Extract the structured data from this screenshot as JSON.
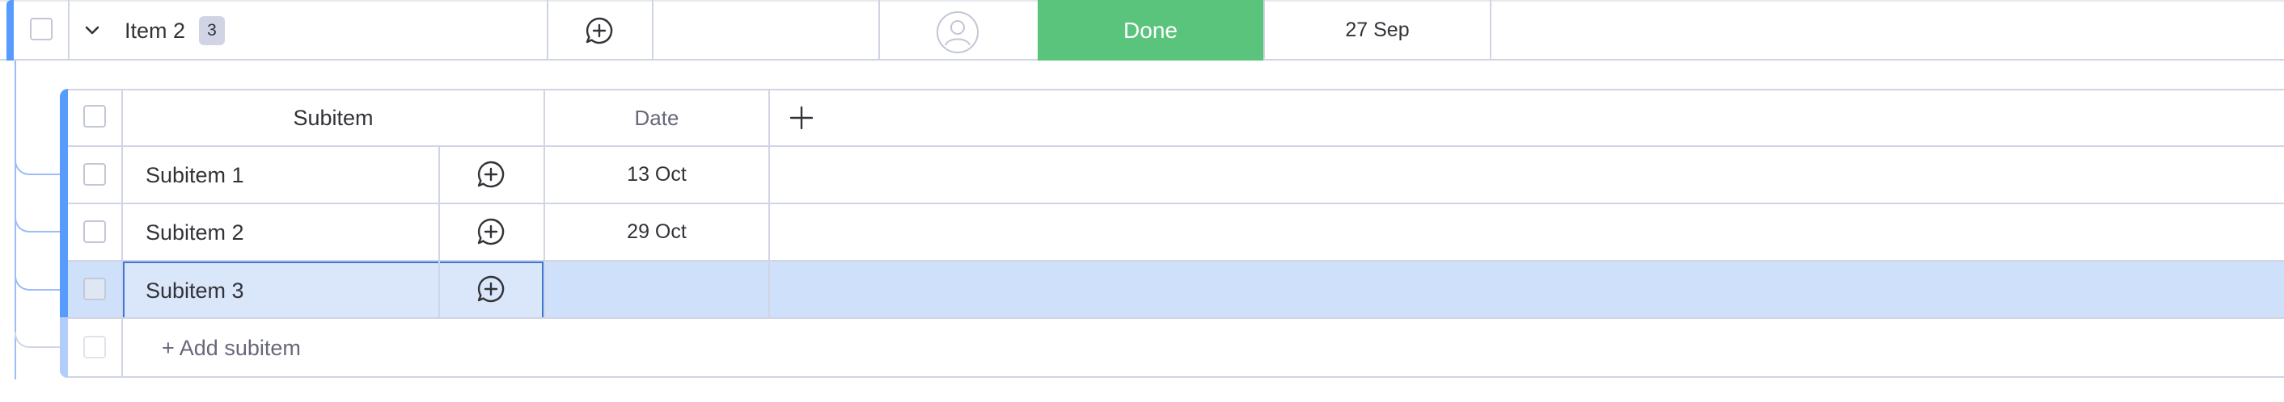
{
  "item": {
    "name": "Item 2",
    "subitem_count": "3",
    "status": "Done",
    "status_color": "#5ac47d",
    "date": "27 Sep",
    "accent_color": "#579bfc"
  },
  "subitems": {
    "columns": {
      "name": "Subitem",
      "date": "Date",
      "add_column_icon": "plus-icon"
    },
    "rows": [
      {
        "name": "Subitem 1",
        "date": "13 Oct"
      },
      {
        "name": "Subitem 2",
        "date": "29 Oct"
      },
      {
        "name": "Subitem 3",
        "date": ""
      }
    ],
    "selected_row_color": "#cfe1fa",
    "add_label": "+ Add subitem"
  },
  "icons": {
    "expand": "chevron-down-icon",
    "update": "add-update-icon",
    "person": "person-icon"
  }
}
